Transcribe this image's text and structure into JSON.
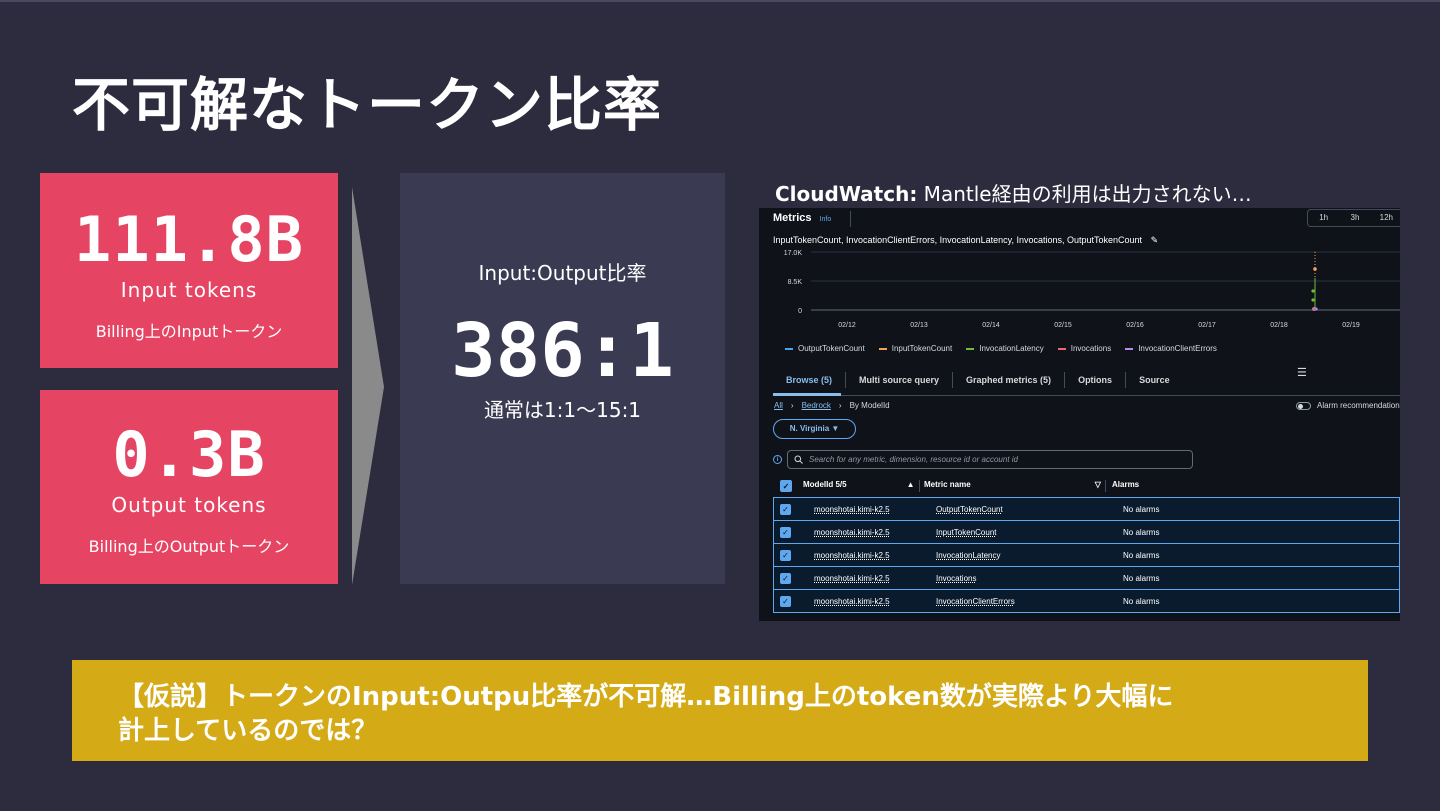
{
  "slide": {
    "title": "不可解なトークン比率"
  },
  "cards": {
    "input": {
      "value": "111.8B",
      "label": "Input tokens",
      "sub": "Billing上のInputトークン"
    },
    "output": {
      "value": "0.3B",
      "label": "Output tokens",
      "sub": "Billing上のOutputトークン"
    }
  },
  "ratio": {
    "label": "Input:Output比率",
    "value": "386:1",
    "note": "通常は1:1〜15:1"
  },
  "cloudwatch": {
    "heading_bold": "CloudWatch:",
    "heading_rest": " Mantle経由の利用は出力されない…",
    "panel_title": "Metrics",
    "info": "Info",
    "time_buttons": [
      "1h",
      "3h",
      "12h"
    ],
    "series_line": "InputTokenCount, InvocationClientErrors, InvocationLatency, Invocations, OutputTokenCount",
    "chart_y_ticks": [
      "17.0K",
      "8.5K",
      "0"
    ],
    "chart_x_ticks": [
      "02/12",
      "02/13",
      "02/14",
      "02/15",
      "02/16",
      "02/17",
      "02/18",
      "02/19"
    ],
    "legend": [
      {
        "name": "OutputTokenCount",
        "color": "#3fa7ee"
      },
      {
        "name": "InputTokenCount",
        "color": "#f5a155"
      },
      {
        "name": "InvocationLatency",
        "color": "#6fbd3a"
      },
      {
        "name": "Invocations",
        "color": "#f06478"
      },
      {
        "name": "InvocationClientErrors",
        "color": "#b78af0"
      }
    ],
    "tabs": [
      "Browse (5)",
      "Multi source query",
      "Graphed metrics (5)",
      "Options",
      "Source"
    ],
    "breadcrumb": {
      "all": "All",
      "bedrock": "Bedrock",
      "current": "By ModelId"
    },
    "alarm_toggle": "Alarm recommendations",
    "region": "N. Virginia ▼",
    "search_placeholder": "Search for any metric, dimension, resource id or account id",
    "columns": {
      "model": "ModelId 5/5",
      "metric": "Metric name",
      "alarms": "Alarms"
    },
    "rows": [
      {
        "model": "moonshotai.kimi-k2.5",
        "metric": "OutputTokenCount",
        "alarms": "No alarms"
      },
      {
        "model": "moonshotai.kimi-k2.5",
        "metric": "InputTokenCount",
        "alarms": "No alarms"
      },
      {
        "model": "moonshotai.kimi-k2.5",
        "metric": "InvocationLatency",
        "alarms": "No alarms"
      },
      {
        "model": "moonshotai.kimi-k2.5",
        "metric": "Invocations",
        "alarms": "No alarms"
      },
      {
        "model": "moonshotai.kimi-k2.5",
        "metric": "InvocationClientErrors",
        "alarms": "No alarms"
      }
    ]
  },
  "banner": {
    "line1": "【仮説】トークンのInput:Outpu比率が不可解…Billing上のtoken数が実際より大幅に",
    "line2": "計上しているのでは？"
  },
  "colors": {
    "background": "#2d2c3e",
    "card": "#e54463",
    "ratio_box": "#3a3a52",
    "banner": "#d4aa16",
    "accent_blue": "#5fa8f0"
  }
}
